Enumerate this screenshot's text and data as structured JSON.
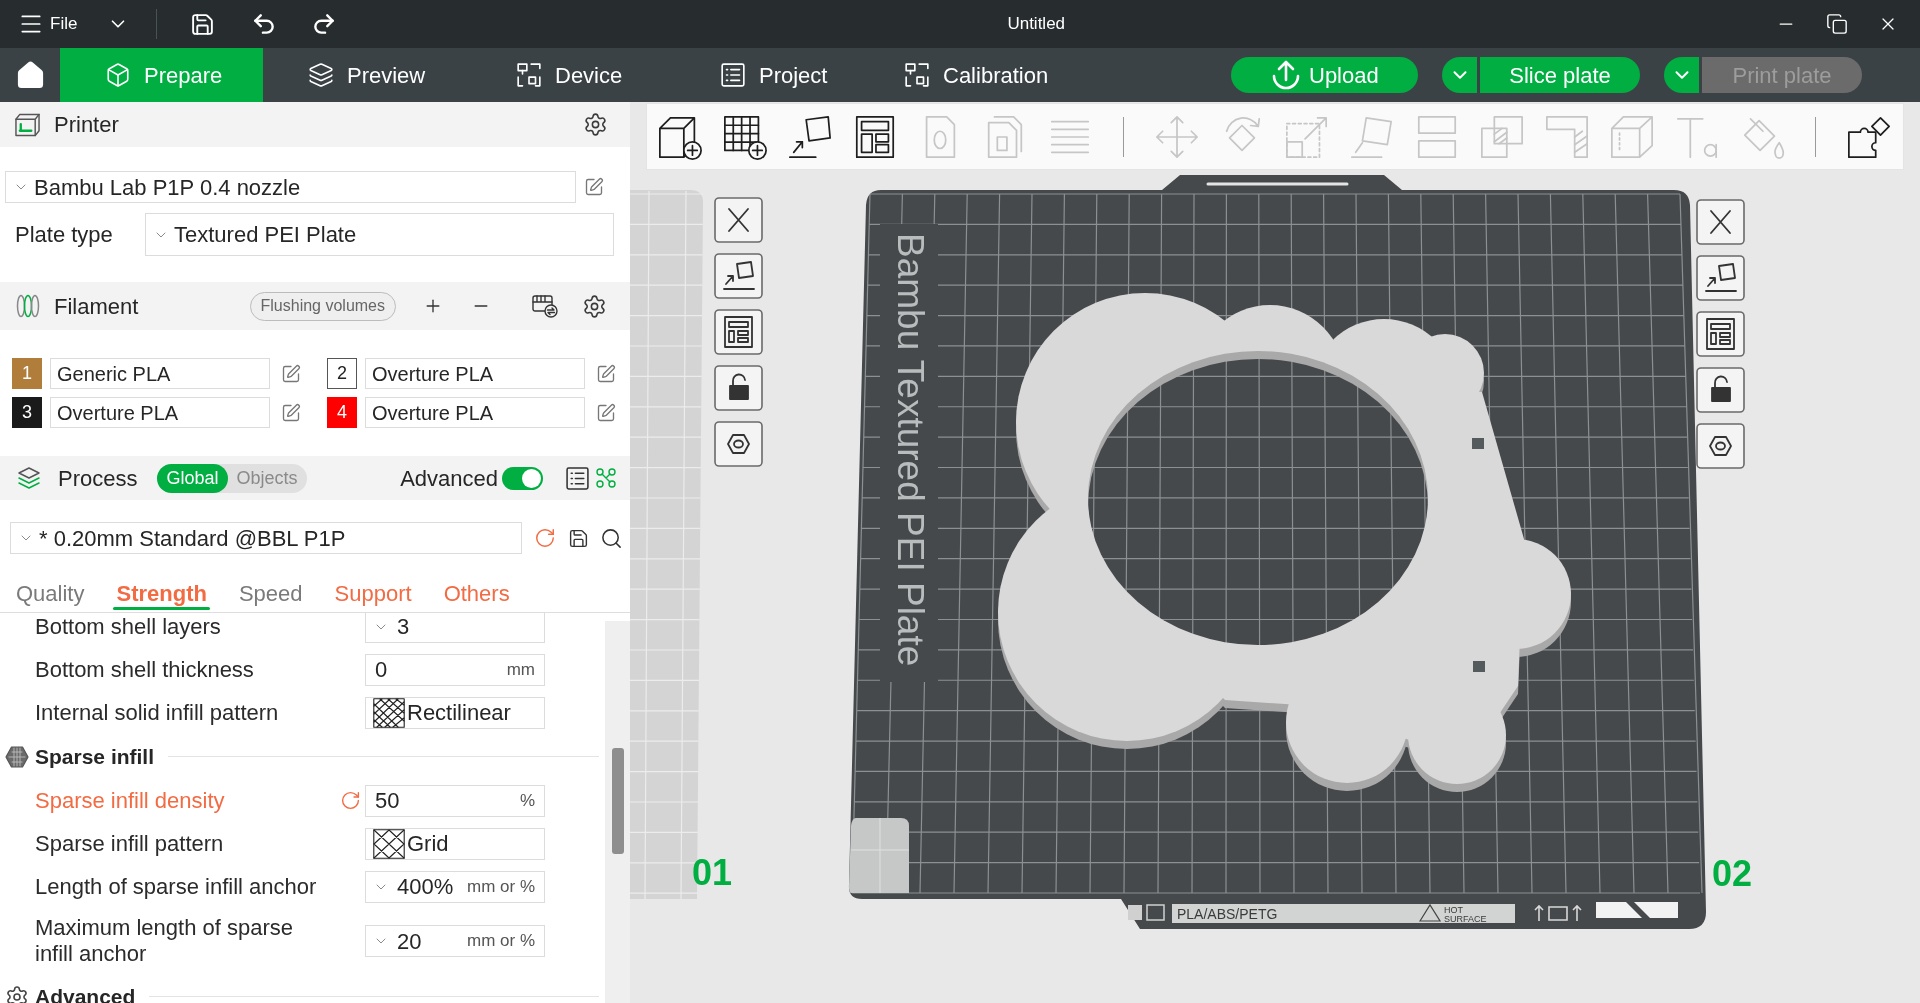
{
  "window": {
    "menu": "File",
    "title": "Untitled"
  },
  "main_tabs": [
    {
      "label": "Prepare",
      "selected": true
    },
    {
      "label": "Preview",
      "selected": false
    },
    {
      "label": "Device",
      "selected": false
    },
    {
      "label": "Project",
      "selected": false
    },
    {
      "label": "Calibration",
      "selected": false
    }
  ],
  "action_buttons": [
    {
      "kind": "single",
      "label": "Upload",
      "disabled": false
    },
    {
      "kind": "split",
      "label": "Slice plate",
      "disabled": false
    },
    {
      "kind": "split",
      "label": "Print plate",
      "disabled": true
    }
  ],
  "sidebar": {
    "printer": {
      "title": "Printer",
      "preset": "Bambu Lab P1P 0.4 nozzle",
      "plate_type_label": "Plate type",
      "plate_type": "Textured PEI Plate"
    },
    "filament": {
      "title": "Filament",
      "flushing_button": "Flushing volumes",
      "slots": [
        {
          "number": "1",
          "color": "#b07d3a",
          "name": "Generic PLA"
        },
        {
          "number": "2",
          "color": "#ffffff",
          "name": "Overture PLA"
        },
        {
          "number": "3",
          "color": "#1a1a1a",
          "name": "Overture PLA"
        },
        {
          "number": "4",
          "color": "#ff0000",
          "name": "Overture PLA"
        }
      ]
    },
    "process": {
      "title": "Process",
      "scope": [
        {
          "label": "Global",
          "selected": true
        },
        {
          "label": "Objects",
          "selected": false
        }
      ],
      "advanced_label": "Advanced",
      "advanced_on": true,
      "preset": "* 0.20mm Standard @BBL P1P",
      "tabs": [
        {
          "label": "Quality",
          "selected": false,
          "modified": false
        },
        {
          "label": "Strength",
          "selected": true,
          "modified": true
        },
        {
          "label": "Speed",
          "selected": false,
          "modified": false
        },
        {
          "label": "Support",
          "selected": false,
          "modified": true
        },
        {
          "label": "Others",
          "selected": false,
          "modified": true
        }
      ]
    },
    "settings": [
      {
        "kind": "combo",
        "label": "Bottom shell layers",
        "value": "3",
        "modified": false
      },
      {
        "kind": "input",
        "label": "Bottom shell thickness",
        "value": "0",
        "unit": "mm",
        "modified": false
      },
      {
        "kind": "pattern",
        "label": "Internal solid infill pattern",
        "value": "Rectilinear",
        "modified": false
      },
      {
        "kind": "section",
        "title": "Sparse infill"
      },
      {
        "kind": "input",
        "label": "Sparse infill density",
        "value": "50",
        "unit": "%",
        "modified": true
      },
      {
        "kind": "pattern",
        "label": "Sparse infill pattern",
        "value": "Grid",
        "modified": false
      },
      {
        "kind": "combo",
        "label": "Length of sparse infill anchor",
        "value": "400%",
        "unit": "mm or %",
        "modified": false
      },
      {
        "kind": "combo",
        "label": "Maximum length of sparse infill anchor",
        "value": "20",
        "unit": "mm or %",
        "modified": false
      },
      {
        "kind": "section",
        "title": "Advanced"
      }
    ]
  },
  "toolbar_groups": [
    {
      "tools": [
        {
          "kind": "add",
          "disabled": false
        },
        {
          "kind": "plate",
          "disabled": false
        },
        {
          "kind": "orient",
          "disabled": false
        },
        {
          "kind": "arrange",
          "disabled": false
        },
        {
          "kind": "split_objects",
          "disabled": true
        },
        {
          "kind": "split_parts",
          "disabled": true
        },
        {
          "kind": "layers",
          "disabled": true
        }
      ]
    },
    {
      "tools": [
        {
          "kind": "move",
          "disabled": true
        },
        {
          "kind": "rotate",
          "disabled": true
        },
        {
          "kind": "scale",
          "disabled": true
        },
        {
          "kind": "lay_on_face",
          "disabled": true
        },
        {
          "kind": "cut",
          "disabled": true
        },
        {
          "kind": "boolean",
          "disabled": true
        },
        {
          "kind": "support_paint",
          "disabled": true
        },
        {
          "kind": "seam_paint",
          "disabled": true
        },
        {
          "kind": "text",
          "disabled": true
        },
        {
          "kind": "color_paint",
          "disabled": true
        }
      ]
    },
    {
      "tools": [
        {
          "kind": "assembly",
          "disabled": false
        }
      ]
    }
  ],
  "plates": [
    {
      "number": "01"
    },
    {
      "number": "02",
      "plate_text": "Bambu Textured PEI Plate",
      "strip_label": "PLA/ABS/PETG",
      "warning": [
        "HOT",
        "SURFACE"
      ]
    }
  ]
}
